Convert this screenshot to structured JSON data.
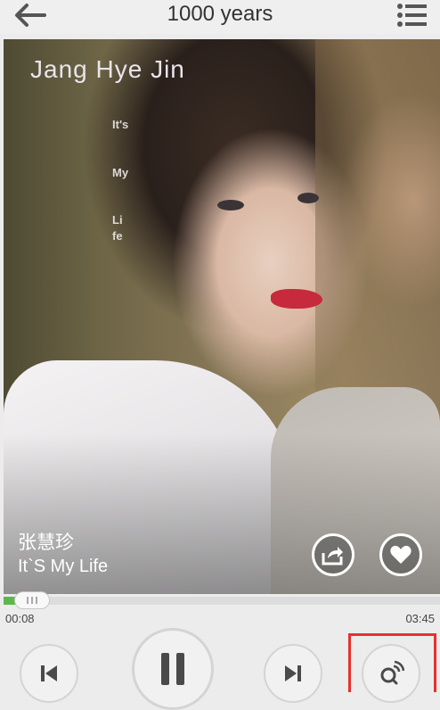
{
  "header": {
    "title": "1000 years",
    "back_icon": "back-arrow-icon",
    "menu_icon": "menu-list-icon"
  },
  "album_art": {
    "artist_logo": "Jang Hye Jin",
    "cover_words": [
      "It's",
      "My",
      "Life"
    ]
  },
  "track": {
    "artist": "张慧珍",
    "title": "It`S My Life"
  },
  "actions": {
    "share_icon": "share-icon",
    "favorite_icon": "heart-icon"
  },
  "progress": {
    "elapsed": "00:08",
    "total": "03:45",
    "fraction": 0.035
  },
  "controls": {
    "prev_icon": "skip-previous-icon",
    "play_pause_icon": "pause-icon",
    "next_icon": "skip-next-icon",
    "mode_icon": "loop-mode-icon"
  },
  "colors": {
    "accent": "#5db84a",
    "highlight": "#e8312f"
  }
}
